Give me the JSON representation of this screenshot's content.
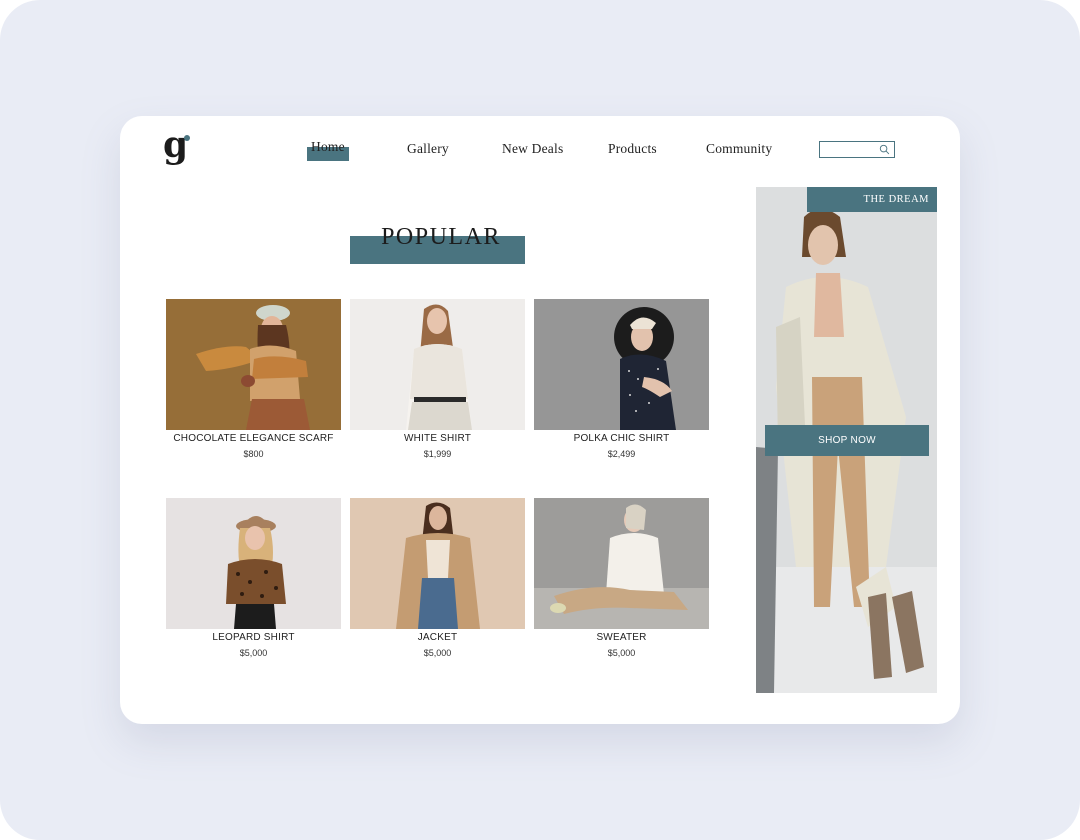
{
  "brand": {
    "logo_letter": "g"
  },
  "nav": {
    "items": [
      {
        "label": "Home",
        "active": true
      },
      {
        "label": "Gallery"
      },
      {
        "label": "New Deals"
      },
      {
        "label": "Products"
      },
      {
        "label": "Community"
      }
    ],
    "search_placeholder": ""
  },
  "section": {
    "title": "POPULAR"
  },
  "products": [
    {
      "name": "CHOCOLATE ELEGANCE SCARF",
      "price": "$800"
    },
    {
      "name": "WHITE SHIRT",
      "price": "$1,999"
    },
    {
      "name": "POLKA CHIC SHIRT",
      "price": "$2,499"
    },
    {
      "name": "LEOPARD SHIRT",
      "price": "$5,000"
    },
    {
      "name": "JACKET",
      "price": "$5,000"
    },
    {
      "name": "SWEATER",
      "price": "$5,000"
    }
  ],
  "hero": {
    "tag": "THE DREAM",
    "cta": "SHOP NOW"
  },
  "colors": {
    "accent": "#4a7480",
    "background": "#e9ecf5",
    "card": "#ffffff"
  }
}
